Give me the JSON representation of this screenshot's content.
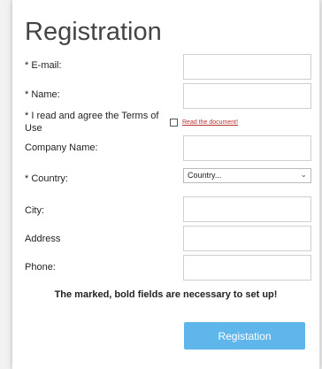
{
  "form": {
    "title": "Registration",
    "email_label": "* E-mail:",
    "name_label": "* Name:",
    "terms_label": "* I read and agree the Terms of Use",
    "terms_link": "Read the document!",
    "company_label": "Company Name:",
    "country_label": "* Country:",
    "country_selected": "Country...",
    "city_label": "City:",
    "address_label": "Address",
    "phone_label": "Phone:",
    "note": "The marked, bold fields are necessary to set up!",
    "submit_label": "Registation"
  },
  "colors": {
    "button": "#5fb6ea",
    "link": "#b33333"
  },
  "icons": {
    "select_chevron": "chevron-down-icon"
  }
}
